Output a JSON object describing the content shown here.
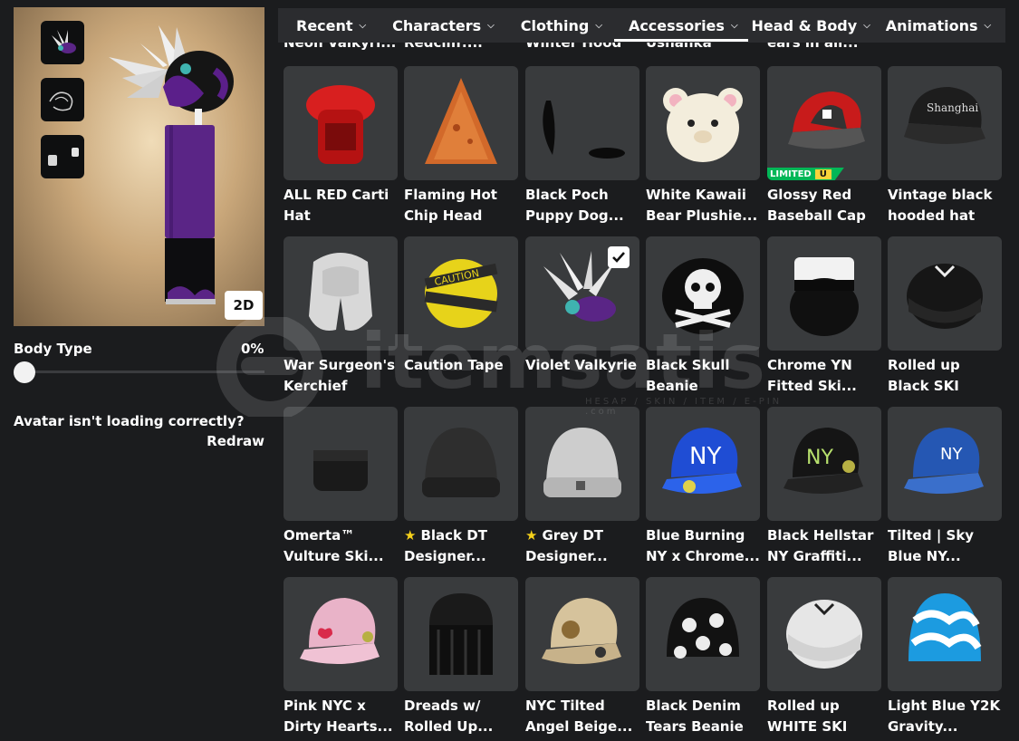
{
  "left_panel": {
    "toggle_2d_label": "2D",
    "body_type_label": "Body Type",
    "body_type_value": "0%",
    "body_type_fraction": 0,
    "loading_question": "Avatar isn't loading correctly?",
    "redraw_label": "Redraw"
  },
  "nav": {
    "tabs": [
      {
        "label": "Recent"
      },
      {
        "label": "Characters"
      },
      {
        "label": "Clothing"
      },
      {
        "label": "Accessories"
      },
      {
        "label": "Head & Body"
      },
      {
        "label": "Animations"
      }
    ],
    "active_tab": "Accessories"
  },
  "partial_row": [
    "Neon Valkyri...",
    "Redcliff:...",
    "Winter Hood",
    "Ushanka",
    "ears in all..."
  ],
  "items": [
    {
      "name": "ALL RED Carti Hat",
      "icon": "red-carti-hat-icon"
    },
    {
      "name": "Flaming Hot Chip Head",
      "icon": "chip-head-icon"
    },
    {
      "name": "Black Poch Puppy Dog...",
      "icon": "puppy-ears-icon"
    },
    {
      "name": "White Kawaii Bear Plushie...",
      "icon": "bear-plushie-icon"
    },
    {
      "name": "Glossy Red Baseball Cap",
      "icon": "red-baseball-cap-icon",
      "badge": "LIMITED",
      "badge_suffix": "U"
    },
    {
      "name": "Vintage black hooded hat",
      "icon": "black-hooded-hat-icon"
    },
    {
      "name": "War Surgeon's Kerchief",
      "icon": "kerchief-icon"
    },
    {
      "name": "Caution Tape",
      "icon": "caution-tape-icon"
    },
    {
      "name": "Violet Valkyrie",
      "icon": "violet-valkyrie-icon",
      "selected": true
    },
    {
      "name": "Black Skull Beanie",
      "icon": "skull-beanie-icon"
    },
    {
      "name": "Chrome YN Fitted Ski...",
      "icon": "chrome-fitted-ski-icon"
    },
    {
      "name": "Rolled up Black SKI",
      "icon": "black-ski-mask-icon"
    },
    {
      "name": "Omerta™ Vulture Ski...",
      "icon": "vulture-ski-icon"
    },
    {
      "name": "Black DT Designer...",
      "icon": "black-dt-beanie-icon",
      "premium": true
    },
    {
      "name": "Grey DT Designer...",
      "icon": "grey-dt-beanie-icon",
      "premium": true
    },
    {
      "name": "Blue Burning NY x Chrome...",
      "icon": "blue-ny-cap-icon"
    },
    {
      "name": "Black Hellstar NY Graffiti...",
      "icon": "hellstar-cap-icon"
    },
    {
      "name": "Tilted | Sky Blue NY...",
      "icon": "sky-blue-ny-cap-icon"
    },
    {
      "name": "Pink NYC x Dirty Hearts...",
      "icon": "pink-nyc-cap-icon"
    },
    {
      "name": "Dreads w/ Rolled Up...",
      "icon": "dreads-icon"
    },
    {
      "name": "NYC Tilted Angel Beige...",
      "icon": "beige-nyc-cap-icon"
    },
    {
      "name": "Black Denim Tears Beanie",
      "icon": "denim-tears-beanie-icon"
    },
    {
      "name": "Rolled up WHITE SKI",
      "icon": "white-ski-mask-icon"
    },
    {
      "name": "Light Blue Y2K Gravity...",
      "icon": "y2k-beanie-icon"
    }
  ],
  "watermark": {
    "text": "itemsatis",
    "subtext": "HESAP / SKIN / ITEM / E-PIN .com"
  }
}
